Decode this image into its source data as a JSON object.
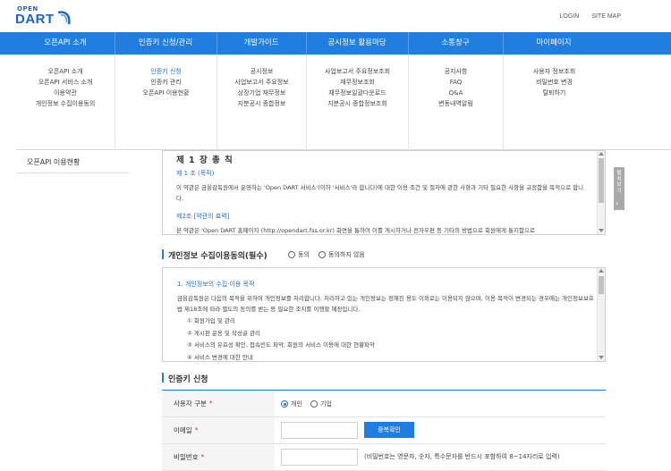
{
  "brand": {
    "logo_top": "OPEN",
    "logo_main": "DART"
  },
  "util": {
    "login": "LOGIN",
    "sitemap": "SITE MAP"
  },
  "gnb": [
    "오픈API 소개",
    "인증키 신청/관리",
    "개발가이드",
    "공시정보 활용마당",
    "소통창구",
    "마이페이지"
  ],
  "dropdown": [
    {
      "items": [
        "오픈API 소개",
        "오픈API 서비스 소개",
        "이용약관",
        "개인정보 수집이용동의"
      ]
    },
    {
      "items": [
        "인증키 신청",
        "인증키 관리",
        "오픈API 이용현황"
      ],
      "active": 0
    },
    {
      "items": [
        "공시정보",
        "사업보고서 주요정보",
        "상장기업 재무정보",
        "지분공시 종합정보"
      ]
    },
    {
      "items": [
        "사업보고서 주요정보조회",
        "재무정보조회",
        "재무정보일괄다운로드",
        "지분공시 종합정보조회"
      ]
    },
    {
      "items": [
        "공지사항",
        "FAQ",
        "Q&A",
        "변동내역알림"
      ]
    },
    {
      "items": [
        "사용자 정보조회",
        "비밀번호 변경",
        "탈퇴하기"
      ]
    }
  ],
  "snb": {
    "current": "오픈API 이용현황"
  },
  "terms": {
    "title": "제 1 장 총 칙",
    "article1_title": "제 1 조 (목적)",
    "article1_text": "이 약관은 금융감독원에서 운영하는 'Open DART 서비스'(이하 '서비스'라 합니다)에 대한 이용 조건 및 절차에 관한 사항과 기타 필요한 사항을 규정함을 목적으로 합니다.",
    "article2_title": "제2조 [약관의 효력]",
    "article2_text": "본 약관은 'Open DART 홈페이지 (http://opendart.fss.or.kr) 화면을 통하여 이를 게시하거나 전자우편 등 기타의 방법으로 회원에게 통지함으로"
  },
  "side_tab": {
    "label": "펼쳐보기"
  },
  "privacy": {
    "section_title": "개인정보 수집이용동의(필수)",
    "agree_label": "동의",
    "disagree_label": "동의하지 않음",
    "heading": "1. 개인정보의 수집·이용 목적",
    "text": "금융감독원은 다음의 목적을 위하여 개인정보를 처리합니다. 처리하고 있는 개인정보는 정해진 용도 이외로는 이용되지 않으며, 이용 목적이 변경되는 경우에는 개인정보보호법 제18조에 따라 별도의 동의를 받는 등 필요한 조치를 이행할 예정입니다.",
    "items": [
      "① 회원가입 및 관리",
      "② 게시판 운용 및 작성글 관리",
      "③ 서비스의 유효성 확인, 접속빈도 파악, 회원의 서비스 이용에 대한 현황파악",
      "④ 서비스 변경에 대한 안내"
    ]
  },
  "apply": {
    "section_title": "인증키 신청",
    "user_type_label": "사용자 구분",
    "user_type_personal": "개인",
    "user_type_company": "기업",
    "email_label": "이메일",
    "email_value": "",
    "dup_check_button": "중복확인",
    "password_label": "비밀번호",
    "password_value": "",
    "password_hint": "(비밀번호는 영문자, 숫자, 특수문자를 반드시 포함하여 8~14자리로 입력)",
    "required_mark": "*"
  },
  "colors": {
    "primary": "#1f7ee0",
    "link": "#1f6fd6",
    "required": "#e23b3b"
  }
}
